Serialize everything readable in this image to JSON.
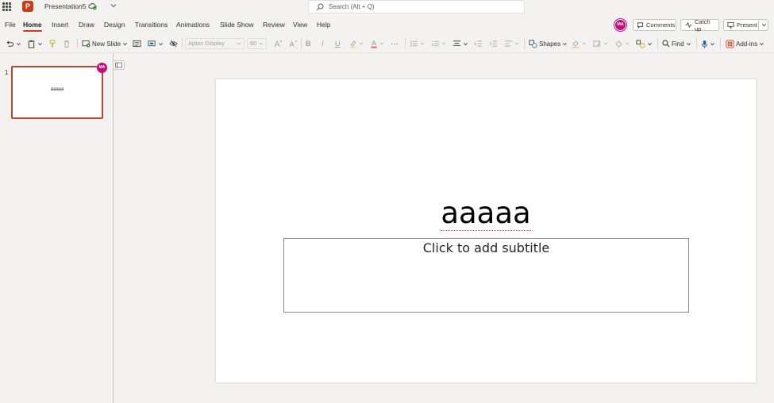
{
  "app": {
    "logo_letter": "P",
    "document_title": "Presentation5"
  },
  "search": {
    "placeholder": "Search (Alt + Q)"
  },
  "tabs": [
    "File",
    "Home",
    "Insert",
    "Draw",
    "Design",
    "Transitions",
    "Animations",
    "Slide Show",
    "Review",
    "View",
    "Help"
  ],
  "active_tab": "Home",
  "user": {
    "initials": "MA"
  },
  "topbar": {
    "comments_label": "Comments",
    "catchup_label": "Catch up",
    "present_label": "Present"
  },
  "ribbon": {
    "new_slide_label": "New Slide",
    "font_name": "Aptos Display",
    "font_size": "60",
    "shapes_label": "Shapes",
    "find_label": "Find",
    "addins_label": "Add-ins"
  },
  "thumbnails": [
    {
      "number": "1",
      "title": "aaaaa"
    }
  ],
  "slide": {
    "title": "aaaaa",
    "subtitle_placeholder": "Click to add subtitle"
  },
  "colors": {
    "accent": "#c43e1c",
    "avatar": "#c30e7a",
    "selection_border": "#b7472a"
  }
}
